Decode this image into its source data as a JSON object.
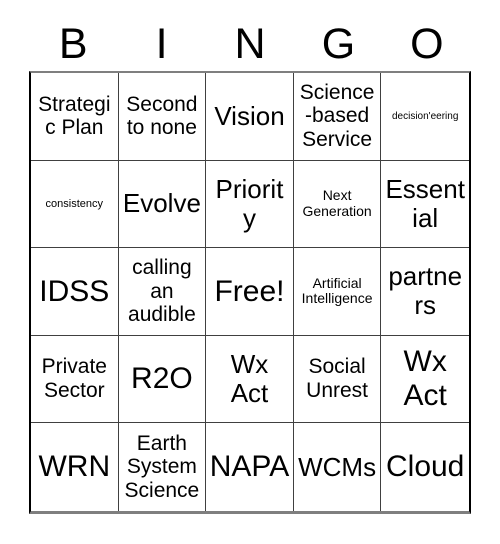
{
  "card": {
    "header_letters": [
      "B",
      "I",
      "N",
      "G",
      "O"
    ],
    "columns": 5,
    "rows": 5,
    "free_space_label": "Free!",
    "free_space_position": [
      2,
      2
    ],
    "border_color": "#000000",
    "grid_line_color": "#404040",
    "background_color": "#ffffff",
    "text_color": "#000000",
    "cells": [
      [
        {
          "text": "Strategic Plan",
          "size": "lg"
        },
        {
          "text": "Second to none",
          "size": "lg"
        },
        {
          "text": "Vision",
          "size": "xl"
        },
        {
          "text": "Science-based Service",
          "size": "lg"
        },
        {
          "text": "decision'eering",
          "size": "xs"
        }
      ],
      [
        {
          "text": "consistency",
          "size": "sm"
        },
        {
          "text": "Evolve",
          "size": "xl"
        },
        {
          "text": "Priority",
          "size": "xl"
        },
        {
          "text": "Next Generation",
          "size": "md"
        },
        {
          "text": "Essential",
          "size": "xl"
        }
      ],
      [
        {
          "text": "IDSS",
          "size": "xxl"
        },
        {
          "text": "calling an audible",
          "size": "lg"
        },
        {
          "text": "Free!",
          "size": "xxl"
        },
        {
          "text": "Artificial Intelligence",
          "size": "md"
        },
        {
          "text": "partners",
          "size": "xl"
        }
      ],
      [
        {
          "text": "Private Sector",
          "size": "lg"
        },
        {
          "text": "R2O",
          "size": "xxl"
        },
        {
          "text": "Wx Act",
          "size": "xl"
        },
        {
          "text": "Social Unrest",
          "size": "lg"
        },
        {
          "text": "Wx Act",
          "size": "xxl"
        }
      ],
      [
        {
          "text": "WRN",
          "size": "xxl"
        },
        {
          "text": "Earth System Science",
          "size": "lg"
        },
        {
          "text": "NAPA",
          "size": "xxl"
        },
        {
          "text": "WCMs",
          "size": "xl"
        },
        {
          "text": "Cloud",
          "size": "xxl"
        }
      ]
    ]
  }
}
